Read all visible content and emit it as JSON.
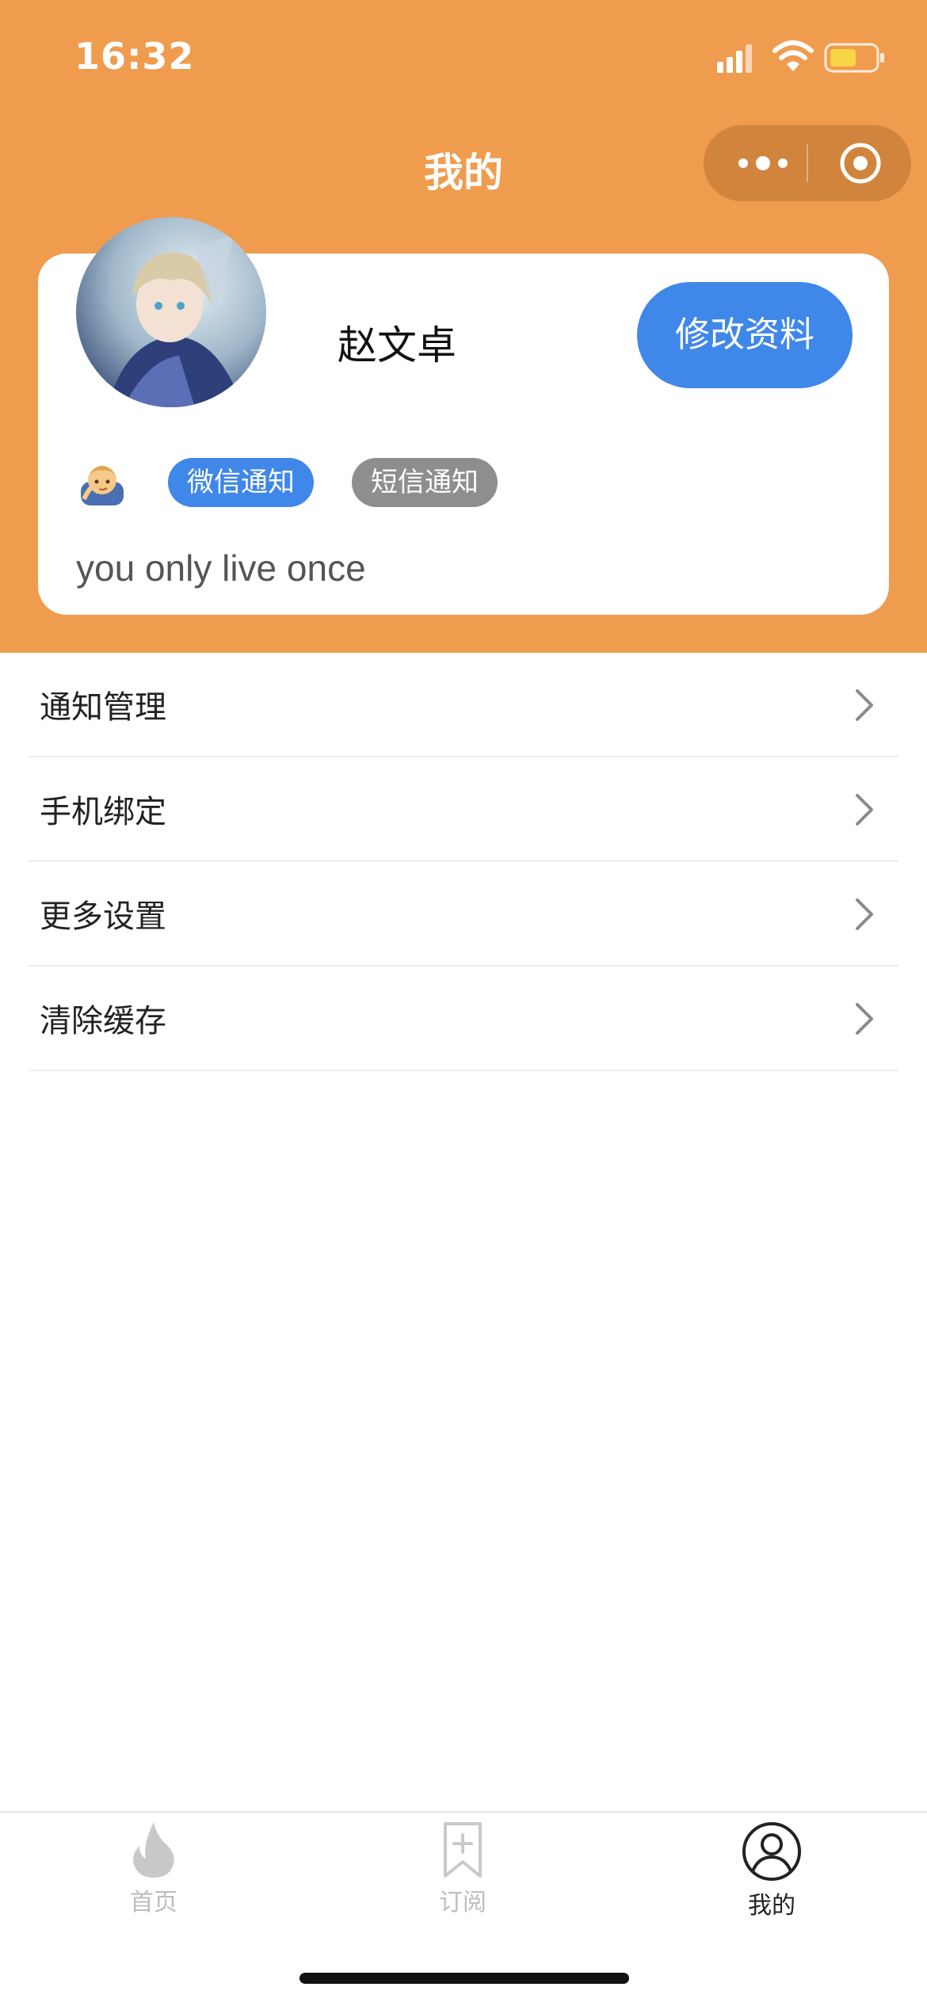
{
  "status_bar": {
    "time": "16:32"
  },
  "nav": {
    "title": "我的"
  },
  "profile": {
    "name": "赵文卓",
    "edit_button": "修改资料",
    "tags": [
      "微信通知",
      "短信通知"
    ],
    "motto": "you only live once"
  },
  "menu": [
    {
      "label": "通知管理"
    },
    {
      "label": "手机绑定"
    },
    {
      "label": "更多设置"
    },
    {
      "label": "清除缓存"
    }
  ],
  "tabbar": {
    "tabs": [
      {
        "label": "首页",
        "icon": "flame-icon"
      },
      {
        "label": "订阅",
        "icon": "bookmark-add-icon"
      },
      {
        "label": "我的",
        "icon": "user-icon",
        "active": true
      }
    ]
  },
  "colors": {
    "header": "#F09C4E",
    "primary": "#3F87E8",
    "tag_gray": "#8E8E8E"
  }
}
